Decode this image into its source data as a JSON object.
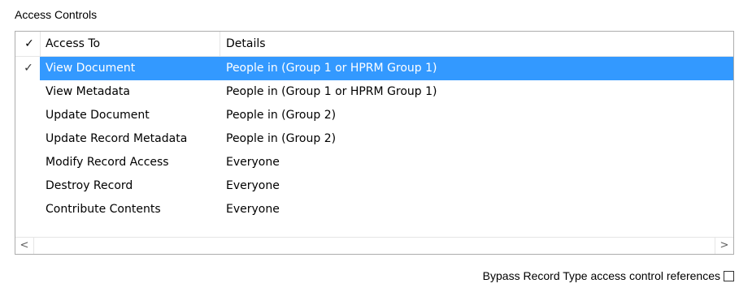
{
  "group": {
    "title": "Access Controls"
  },
  "list": {
    "header": {
      "check_glyph": "✓",
      "access_to": "Access To",
      "details": "Details"
    },
    "rows": [
      {
        "checked": true,
        "check_glyph": "✓",
        "access_to": "View Document",
        "details": "People in (Group 1 or HPRM Group 1)",
        "selected": true
      },
      {
        "checked": false,
        "check_glyph": "",
        "access_to": "View Metadata",
        "details": "People in (Group 1 or HPRM Group 1)",
        "selected": false
      },
      {
        "checked": false,
        "check_glyph": "",
        "access_to": "Update Document",
        "details": "People in (Group 2)",
        "selected": false
      },
      {
        "checked": false,
        "check_glyph": "",
        "access_to": "Update Record Metadata",
        "details": "People in (Group 2)",
        "selected": false
      },
      {
        "checked": false,
        "check_glyph": "",
        "access_to": "Modify Record Access",
        "details": "Everyone",
        "selected": false
      },
      {
        "checked": false,
        "check_glyph": "",
        "access_to": "Destroy Record",
        "details": "Everyone",
        "selected": false
      },
      {
        "checked": false,
        "check_glyph": "",
        "access_to": "Contribute Contents",
        "details": "Everyone",
        "selected": false
      }
    ],
    "scroll_left_glyph": "<",
    "scroll_right_glyph": ">"
  },
  "bypass": {
    "label": "Bypass Record Type access control references",
    "checked": false
  },
  "colors": {
    "selection": "#3399ff",
    "border": "#adadad"
  }
}
